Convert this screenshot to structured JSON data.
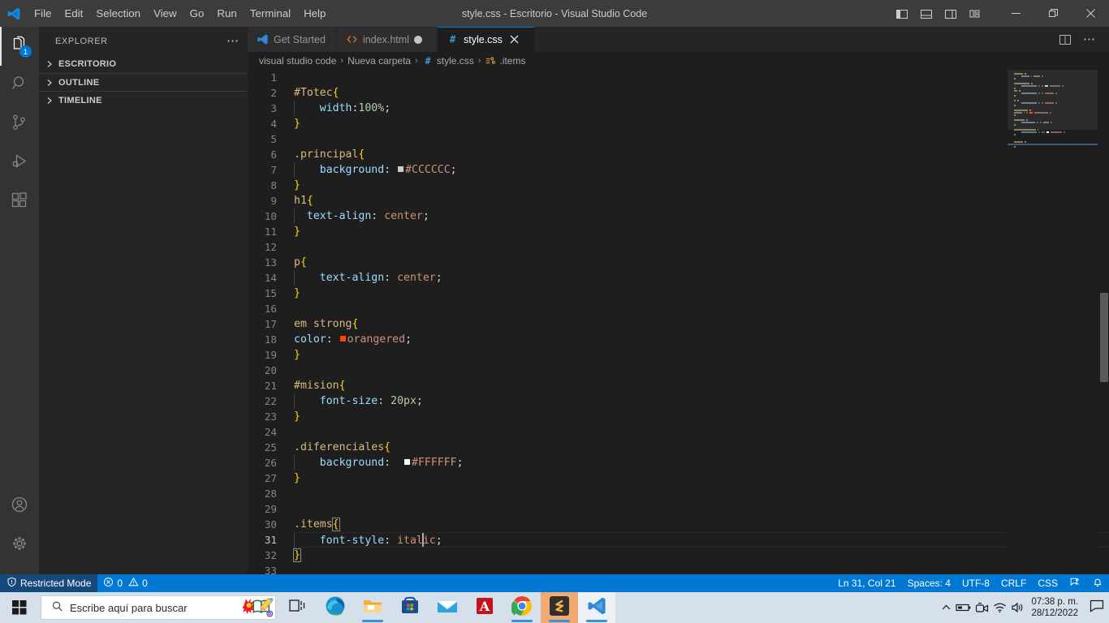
{
  "titlebar": {
    "logo_icon": "vscode-logo-icon",
    "title": "style.css - Escritorio - Visual Studio Code",
    "menus": [
      {
        "label": "File"
      },
      {
        "label": "Edit"
      },
      {
        "label": "Selection"
      },
      {
        "label": "View"
      },
      {
        "label": "Go"
      },
      {
        "label": "Run"
      },
      {
        "label": "Terminal"
      },
      {
        "label": "Help"
      }
    ],
    "layout_buttons": [
      {
        "name": "toggle-primary-sidebar-icon"
      },
      {
        "name": "toggle-panel-icon"
      },
      {
        "name": "toggle-secondary-sidebar-icon"
      },
      {
        "name": "customize-layout-icon"
      }
    ],
    "window_controls": [
      {
        "name": "minimize-button"
      },
      {
        "name": "restore-button"
      },
      {
        "name": "close-button"
      }
    ]
  },
  "activitybar": {
    "items": [
      {
        "name": "explorer",
        "icon": "files-icon",
        "active": true,
        "badge": "1"
      },
      {
        "name": "search",
        "icon": "search-icon",
        "active": false,
        "badge": ""
      },
      {
        "name": "source-control",
        "icon": "source-control-icon",
        "active": false,
        "badge": ""
      },
      {
        "name": "run-debug",
        "icon": "run-and-debug-icon",
        "active": false,
        "badge": ""
      },
      {
        "name": "extensions",
        "icon": "extensions-icon",
        "active": false,
        "badge": ""
      }
    ],
    "bottom_items": [
      {
        "name": "accounts",
        "icon": "account-icon"
      },
      {
        "name": "manage",
        "icon": "gear-icon"
      }
    ]
  },
  "sidebar": {
    "header_title": "EXPLORER",
    "more_actions_icon": "ellipsis-icon",
    "sections": [
      {
        "label": "ESCRITORIO",
        "expanded": false
      },
      {
        "label": "OUTLINE",
        "expanded": false
      },
      {
        "label": "TIMELINE",
        "expanded": false
      }
    ]
  },
  "editor": {
    "tabs": [
      {
        "label": "Get Started",
        "icon": "vscode-logo-icon",
        "active": false,
        "dirty": false,
        "closable": false
      },
      {
        "label": "index.html",
        "icon": "html-icon",
        "active": false,
        "dirty": true,
        "closable": false
      },
      {
        "label": "style.css",
        "icon": "css-icon",
        "active": true,
        "dirty": false,
        "closable": true
      }
    ],
    "tab_actions": [
      {
        "name": "split-editor-right-icon"
      },
      {
        "name": "more-actions-icon"
      }
    ],
    "breadcrumbs": [
      {
        "label": "visual studio code",
        "icon": ""
      },
      {
        "label": "Nueva carpeta",
        "icon": ""
      },
      {
        "label": "style.css",
        "icon": "css-icon"
      },
      {
        "label": ".items",
        "icon": "css-symbol-icon"
      }
    ],
    "breadcrumb_separator": "›",
    "current_line": 31,
    "lines": [
      {
        "n": 1,
        "tokens": []
      },
      {
        "n": 2,
        "tokens": [
          {
            "t": "#Totec",
            "c": "sel"
          },
          {
            "t": "{",
            "c": "brace-y"
          }
        ]
      },
      {
        "n": 3,
        "indent": 1,
        "tokens": [
          {
            "t": "width",
            "c": "prop"
          },
          {
            "t": ":",
            "c": "punc"
          },
          {
            "t": "100%",
            "c": "num"
          },
          {
            "t": ";",
            "c": "punc"
          }
        ]
      },
      {
        "n": 4,
        "tokens": [
          {
            "t": "}",
            "c": "brace-y"
          }
        ]
      },
      {
        "n": 5,
        "tokens": []
      },
      {
        "n": 6,
        "tokens": [
          {
            "t": ".principal",
            "c": "sel"
          },
          {
            "t": "{",
            "c": "brace-y"
          }
        ]
      },
      {
        "n": 7,
        "indent": 1,
        "tokens": [
          {
            "t": "background",
            "c": "prop"
          },
          {
            "t": ":",
            "c": "punc"
          },
          {
            "t": " ",
            "c": "punc"
          },
          {
            "t": "",
            "c": "swatch",
            "color": "#CCCCCC"
          },
          {
            "t": "#CCCCCC",
            "c": "val"
          },
          {
            "t": ";",
            "c": "punc"
          }
        ]
      },
      {
        "n": 8,
        "tokens": [
          {
            "t": "}",
            "c": "brace-y"
          }
        ]
      },
      {
        "n": 9,
        "tokens": [
          {
            "t": "h1",
            "c": "sel"
          },
          {
            "t": "{",
            "c": "brace-y"
          }
        ]
      },
      {
        "n": 10,
        "indent": 1,
        "shortindent": true,
        "tokens": [
          {
            "t": "text-align",
            "c": "prop"
          },
          {
            "t": ":",
            "c": "punc"
          },
          {
            "t": " ",
            "c": "punc"
          },
          {
            "t": "center",
            "c": "val"
          },
          {
            "t": ";",
            "c": "punc"
          }
        ]
      },
      {
        "n": 11,
        "tokens": [
          {
            "t": "}",
            "c": "brace-y"
          }
        ]
      },
      {
        "n": 12,
        "tokens": []
      },
      {
        "n": 13,
        "tokens": [
          {
            "t": "p",
            "c": "sel"
          },
          {
            "t": "{",
            "c": "brace-y"
          }
        ]
      },
      {
        "n": 14,
        "indent": 1,
        "tokens": [
          {
            "t": "text-align",
            "c": "prop"
          },
          {
            "t": ":",
            "c": "punc"
          },
          {
            "t": " ",
            "c": "punc"
          },
          {
            "t": "center",
            "c": "val"
          },
          {
            "t": ";",
            "c": "punc"
          }
        ]
      },
      {
        "n": 15,
        "tokens": [
          {
            "t": "}",
            "c": "brace-y"
          }
        ]
      },
      {
        "n": 16,
        "tokens": []
      },
      {
        "n": 17,
        "tokens": [
          {
            "t": "em strong",
            "c": "sel"
          },
          {
            "t": "{",
            "c": "brace-y"
          }
        ]
      },
      {
        "n": 18,
        "tokens": [
          {
            "t": "color",
            "c": "prop"
          },
          {
            "t": ":",
            "c": "punc"
          },
          {
            "t": " ",
            "c": "punc"
          },
          {
            "t": "",
            "c": "swatch",
            "color": "#FF4500"
          },
          {
            "t": "orangered",
            "c": "val"
          },
          {
            "t": ";",
            "c": "punc"
          }
        ]
      },
      {
        "n": 19,
        "tokens": [
          {
            "t": "}",
            "c": "brace-y"
          }
        ]
      },
      {
        "n": 20,
        "tokens": []
      },
      {
        "n": 21,
        "tokens": [
          {
            "t": "#mision",
            "c": "sel"
          },
          {
            "t": "{",
            "c": "brace-y"
          }
        ]
      },
      {
        "n": 22,
        "indent": 1,
        "tokens": [
          {
            "t": "font-size",
            "c": "prop"
          },
          {
            "t": ":",
            "c": "punc"
          },
          {
            "t": " ",
            "c": "punc"
          },
          {
            "t": "20px",
            "c": "num"
          },
          {
            "t": ";",
            "c": "punc"
          }
        ]
      },
      {
        "n": 23,
        "tokens": [
          {
            "t": "}",
            "c": "brace-y"
          }
        ]
      },
      {
        "n": 24,
        "tokens": []
      },
      {
        "n": 25,
        "tokens": [
          {
            "t": ".diferenciales",
            "c": "sel"
          },
          {
            "t": "{",
            "c": "brace-y"
          }
        ]
      },
      {
        "n": 26,
        "indent": 1,
        "tokens": [
          {
            "t": "background",
            "c": "prop"
          },
          {
            "t": ":",
            "c": "punc"
          },
          {
            "t": "  ",
            "c": "punc"
          },
          {
            "t": "",
            "c": "swatch",
            "color": "#FFFFFF"
          },
          {
            "t": "#FFFFFF",
            "c": "val"
          },
          {
            "t": ";",
            "c": "punc"
          }
        ]
      },
      {
        "n": 27,
        "tokens": [
          {
            "t": "}",
            "c": "brace-y"
          }
        ]
      },
      {
        "n": 28,
        "tokens": []
      },
      {
        "n": 29,
        "tokens": []
      },
      {
        "n": 30,
        "tokens": [
          {
            "t": ".items",
            "c": "sel"
          },
          {
            "t": "{",
            "c": "brace-box"
          }
        ]
      },
      {
        "n": 31,
        "indent": 1,
        "current": true,
        "tokens": [
          {
            "t": "font-style",
            "c": "prop"
          },
          {
            "t": ":",
            "c": "punc"
          },
          {
            "t": " ",
            "c": "punc"
          },
          {
            "t": "ital",
            "c": "val"
          },
          {
            "t": "",
            "c": "cursor"
          },
          {
            "t": "ic",
            "c": "val"
          },
          {
            "t": ";",
            "c": "punc"
          }
        ]
      },
      {
        "n": 32,
        "tokens": [
          {
            "t": "}",
            "c": "brace-box"
          }
        ]
      },
      {
        "n": 33,
        "tokens": []
      }
    ]
  },
  "statusbar": {
    "left": [
      {
        "name": "restricted-mode",
        "label": "Restricted Mode",
        "icon": "shield-icon"
      },
      {
        "name": "problems",
        "label": "0",
        "icon": "error-icon",
        "label2": "0",
        "icon2": "warning-icon"
      }
    ],
    "right": [
      {
        "name": "cursor-position",
        "label": "Ln 31, Col 21"
      },
      {
        "name": "indentation",
        "label": "Spaces: 4"
      },
      {
        "name": "encoding",
        "label": "UTF-8"
      },
      {
        "name": "eol",
        "label": "CRLF"
      },
      {
        "name": "language-mode",
        "label": "CSS"
      },
      {
        "name": "feedback",
        "label": "",
        "icon": "feedback-icon"
      },
      {
        "name": "notifications",
        "label": "",
        "icon": "bell-icon"
      }
    ]
  },
  "taskbar": {
    "start_icon": "windows-start-icon",
    "search_placeholder": "Escribe aquí para buscar",
    "search_icon": "search-icon",
    "cortana_icon": "paint-3d-icon",
    "apps": [
      {
        "name": "task-view",
        "icon": "task-view-icon",
        "running": false,
        "state": ""
      },
      {
        "name": "microsoft-edge",
        "icon": "edge-icon",
        "running": false,
        "state": ""
      },
      {
        "name": "file-explorer",
        "icon": "folder-icon",
        "running": true,
        "state": ""
      },
      {
        "name": "microsoft-store",
        "icon": "store-icon",
        "running": false,
        "state": ""
      },
      {
        "name": "mail",
        "icon": "mail-icon",
        "running": false,
        "state": ""
      },
      {
        "name": "adobe-acrobat",
        "icon": "acrobat-icon",
        "running": false,
        "state": ""
      },
      {
        "name": "google-chrome",
        "icon": "chrome-icon",
        "running": true,
        "state": ""
      },
      {
        "name": "sublime-text",
        "icon": "sublime-icon",
        "running": true,
        "state": "sublime"
      },
      {
        "name": "visual-studio-code",
        "icon": "vscode-icon",
        "running": true,
        "state": "active"
      }
    ],
    "tray": [
      {
        "name": "show-hidden-icons",
        "icon": "chevron-up-icon"
      },
      {
        "name": "battery",
        "icon": "battery-icon"
      },
      {
        "name": "meet-now",
        "icon": "meet-now-icon"
      },
      {
        "name": "network",
        "icon": "wifi-icon"
      },
      {
        "name": "volume",
        "icon": "speaker-icon"
      }
    ],
    "clock": {
      "time": "07:38 p. m.",
      "date": "28/12/2022"
    },
    "action_center_icon": "action-center-icon"
  },
  "colors": {
    "accent": "#0078d4",
    "titlebar_bg": "#3c3c3c",
    "sidebar_bg": "#252526",
    "editor_bg": "#1e1e1e",
    "activitybar_bg": "#333333",
    "taskbar_bg": "#d6e0ea"
  }
}
